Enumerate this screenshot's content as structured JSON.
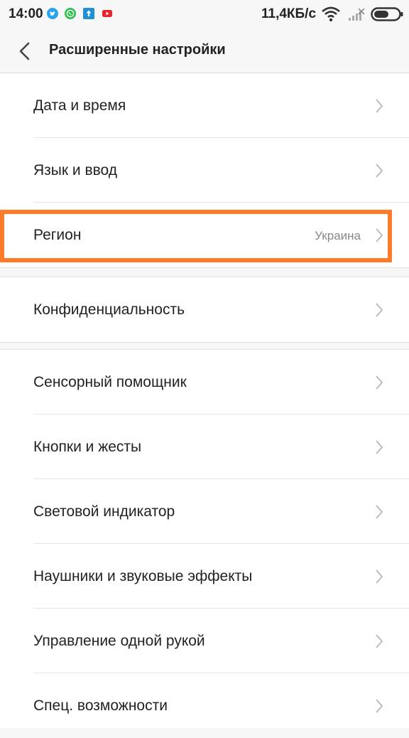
{
  "status_bar": {
    "time": "14:00",
    "network_speed": "11,4КБ/с",
    "notification_icons": [
      "twitter-icon",
      "whatsapp-icon",
      "upload-icon",
      "youtube-icon"
    ],
    "system_icons": [
      "wifi-icon",
      "signal-icon",
      "battery-icon"
    ]
  },
  "header": {
    "title": "Расширенные настройки",
    "back_icon": "chevron-left-icon"
  },
  "groups": [
    {
      "items": [
        {
          "label": "Дата и время"
        },
        {
          "label": "Язык и ввод"
        },
        {
          "label": "Регион",
          "value": "Украина"
        }
      ]
    },
    {
      "items": [
        {
          "label": "Конфиденциальность"
        }
      ]
    },
    {
      "items": [
        {
          "label": "Сенсорный помощник"
        },
        {
          "label": "Кнопки и жесты"
        },
        {
          "label": "Световой индикатор"
        },
        {
          "label": "Наушники и звуковые эффекты"
        },
        {
          "label": "Управление одной рукой"
        },
        {
          "label": "Спец. возможности"
        }
      ]
    }
  ],
  "colors": {
    "highlight": "#ff7a29",
    "background": "#f7f7f7",
    "list_background": "#ffffff"
  }
}
